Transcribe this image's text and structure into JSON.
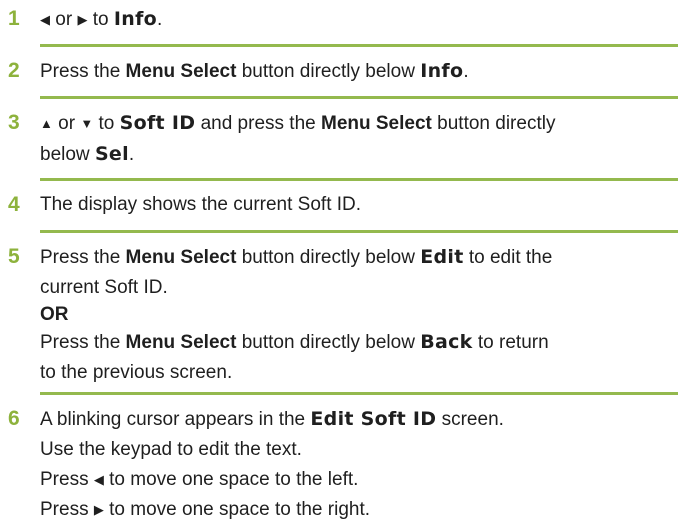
{
  "steps": [
    {
      "num": "1",
      "text": {
        "arrow_left": "◀",
        "or": "or",
        "arrow_right": "▶",
        "to": "to",
        "menu": "Info",
        "end": "."
      }
    },
    {
      "num": "2",
      "text": {
        "a": "Press the",
        "b": "Menu Select",
        "c": "button directly below",
        "d": "Info",
        "end": "."
      }
    },
    {
      "num": "3",
      "text": {
        "up": "▲",
        "or": "or",
        "down": "▼",
        "to": "to",
        "item": "Soft ID",
        "mid": "and press the",
        "b": "Menu Select",
        "c": "button directly",
        "line2a": "below",
        "d": "Sel",
        "end": "."
      }
    },
    {
      "num": "4",
      "text": {
        "a": "The display shows the current Soft ID."
      }
    },
    {
      "num": "5",
      "text": {
        "a": "Press the",
        "b": "Menu Select",
        "c": "button directly below",
        "d": "Edit",
        "e": "to edit the",
        "line2": "current Soft ID.",
        "or": "OR",
        "f": "Press the",
        "g": "Menu Select",
        "h": "button directly below",
        "i": "Back",
        "j": "to return",
        "line5": "to the previous screen."
      }
    },
    {
      "num": "6",
      "text": {
        "a": "A blinking cursor appears in the",
        "screen_name": "Edit Soft ID",
        "b": "screen.",
        "line2": "Use the keypad to edit the text.",
        "l3a": "Press",
        "l3arrow": "◀",
        "l3b": "to move one space to the left.",
        "l4a": "Press",
        "l4arrow": "▶",
        "l4b": "to move one space to the right."
      }
    }
  ]
}
